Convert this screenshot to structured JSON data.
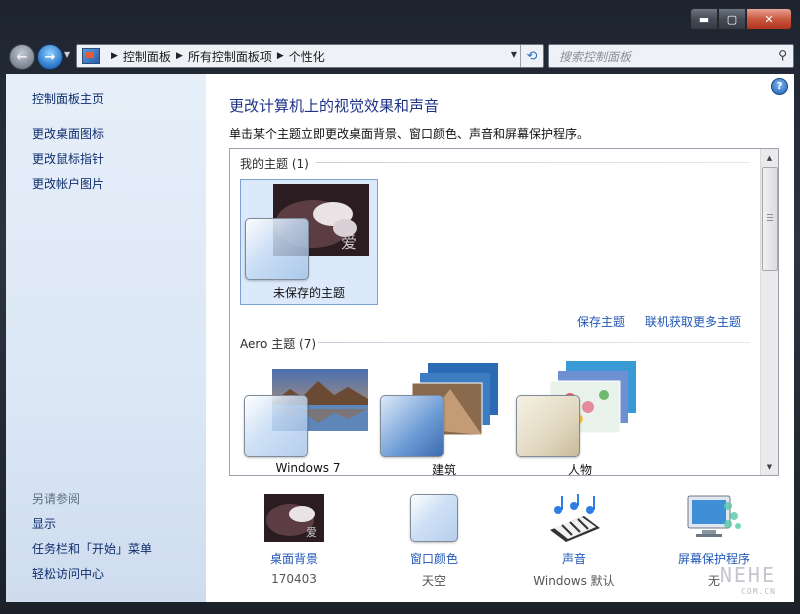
{
  "window": {
    "caption_buttons": {
      "minimize": "▬",
      "maximize": "▢",
      "close": "✕"
    }
  },
  "nav": {
    "back_glyph": "←",
    "forward_glyph": "→",
    "breadcrumbs": [
      "控制面板",
      "所有控制面板项",
      "个性化"
    ],
    "search_placeholder": "搜索控制面板",
    "refresh_glyph": "⟲",
    "search_glyph": "⚲"
  },
  "left_pane": {
    "links": [
      "控制面板主页",
      "更改桌面图标",
      "更改鼠标指针",
      "更改帐户图片"
    ],
    "see_also_title": "另请参阅",
    "see_also": [
      "显示",
      "任务栏和「开始」菜单",
      "轻松访问中心"
    ]
  },
  "main": {
    "title": "更改计算机上的视觉效果和声音",
    "subtitle": "单击某个主题立即更改桌面背景、窗口颜色、声音和屏幕保护程序。",
    "my_themes": {
      "header": "我的主题 (1)",
      "items": [
        {
          "label": "未保存的主题"
        }
      ],
      "save_link": "保存主题",
      "online_link": "联机获取更多主题"
    },
    "aero_themes": {
      "header": "Aero 主题 (7)",
      "items": [
        {
          "label": "Windows 7"
        },
        {
          "label": "建筑"
        },
        {
          "label": "人物"
        }
      ]
    }
  },
  "bottom": [
    {
      "label": "桌面背景",
      "value": "170403",
      "icon": "desktop-background-icon"
    },
    {
      "label": "窗口颜色",
      "value": "天空",
      "icon": "window-color-icon"
    },
    {
      "label": "声音",
      "value": "Windows 默认",
      "icon": "sounds-icon"
    },
    {
      "label": "屏幕保护程序",
      "value": "无",
      "icon": "screensaver-icon"
    }
  ],
  "watermark": {
    "line1": "NEHE",
    "line2": "COM.CN"
  },
  "colors": {
    "link": "#1f57b7",
    "title": "#1e3287",
    "selected_tile": "#dbe9fb"
  }
}
